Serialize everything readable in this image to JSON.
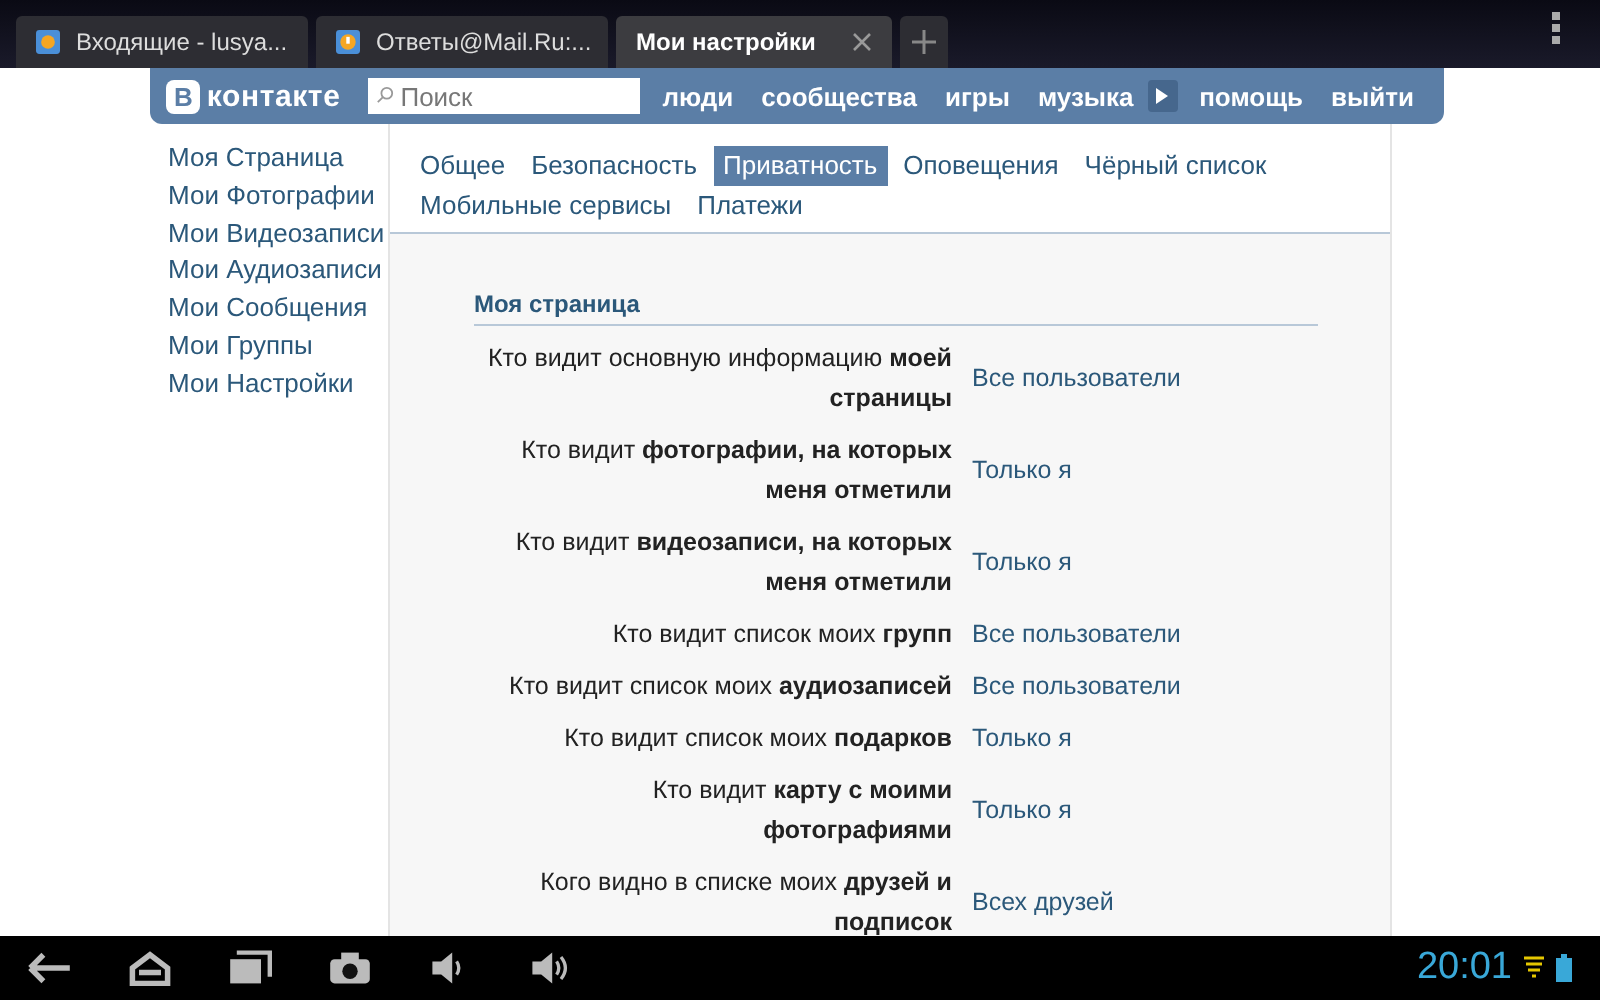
{
  "browser_tabs": [
    {
      "title": "Входящие - lusya...",
      "selected": false
    },
    {
      "title": "Ответы@Mail.Ru:...",
      "selected": false
    },
    {
      "title": "Мои настройки",
      "selected": true
    }
  ],
  "header": {
    "logo": "контакте",
    "logo_letter": "В",
    "search": {
      "placeholder": "Поиск"
    },
    "nav": [
      "люди",
      "сообщества",
      "игры",
      "музыка"
    ],
    "nav_right": [
      "помощь",
      "выйти"
    ]
  },
  "sidebar": {
    "items": [
      "Моя Страница",
      "Мои Фотографии",
      "Мои Видеозаписи",
      "Мои Аудиозаписи",
      "Мои Сообщения",
      "Мои Группы",
      "Мои Настройки"
    ]
  },
  "settings_tabs": [
    {
      "label": "Общее",
      "selected": false
    },
    {
      "label": "Безопасность",
      "selected": false
    },
    {
      "label": "Приватность",
      "selected": true
    },
    {
      "label": "Оповещения",
      "selected": false
    },
    {
      "label": "Чёрный список",
      "selected": false
    },
    {
      "label": "Мобильные сервисы",
      "selected": false
    },
    {
      "label": "Платежи",
      "selected": false
    }
  ],
  "section_title": "Моя страница",
  "privacy_rows": [
    {
      "question": "Кто видит основную информацию **моей страницы**",
      "value": "Все пользователи"
    },
    {
      "question": "Кто видит **фотографии, на которых меня отметили**",
      "value": "Только я"
    },
    {
      "question": "Кто видит **видеозаписи, на которых меня отметили**",
      "value": "Только я"
    },
    {
      "question": "Кто видит список моих **групп**",
      "value": "Все пользователи"
    },
    {
      "question": "Кто видит список моих **аудиозаписей**",
      "value": "Все пользователи"
    },
    {
      "question": "Кто видит список моих **подарков**",
      "value": "Только я"
    },
    {
      "question": "Кто видит **карту с моими фотографиями**",
      "value": "Только я"
    },
    {
      "question": "Кого видно в списке моих **друзей и подписок**",
      "value": "Всех друзей"
    }
  ],
  "status_bar": {
    "time": "20:01"
  }
}
